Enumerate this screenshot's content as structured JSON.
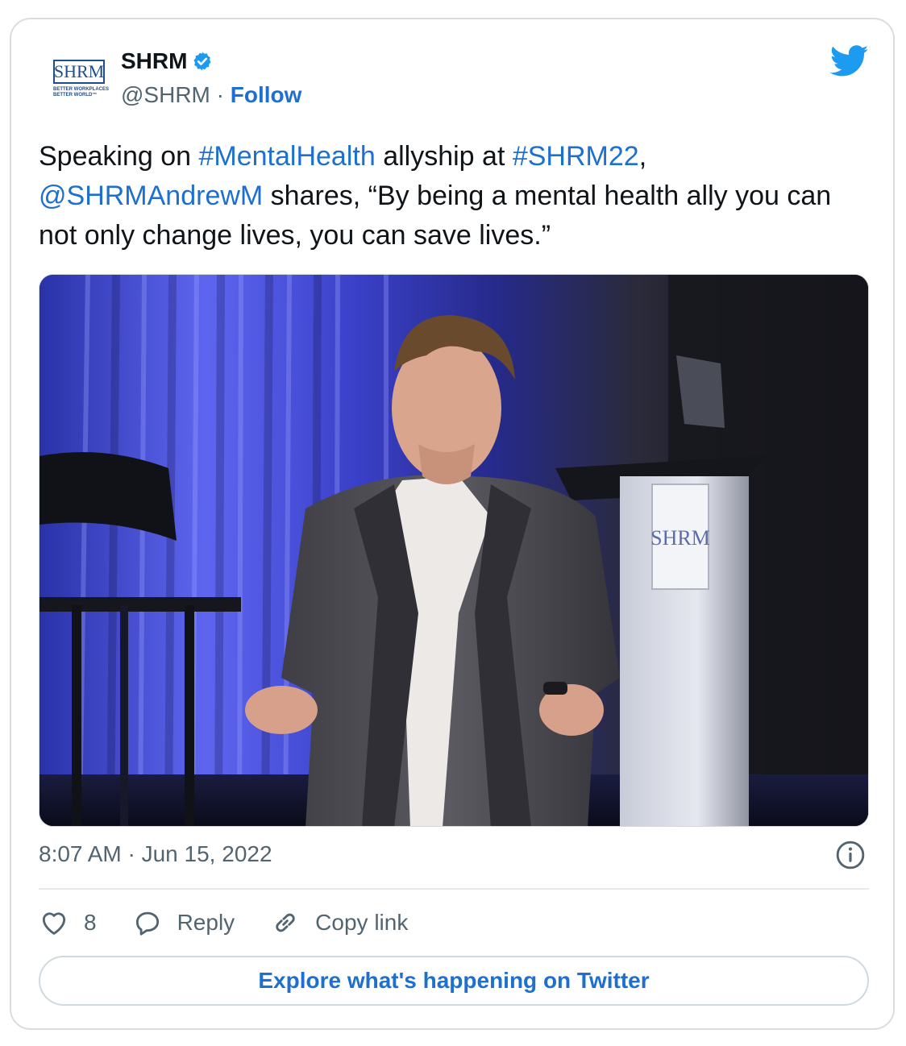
{
  "author": {
    "name": "SHRM",
    "handle": "@SHRM",
    "separator": " · ",
    "follow_label": "Follow",
    "avatar_logo": "SHRM",
    "avatar_tagline": "BETTER WORKPLACES BETTER WORLD™",
    "verified": true
  },
  "tweet": {
    "text_parts": [
      {
        "text": "Speaking on ",
        "link": false
      },
      {
        "text": "#MentalHealth",
        "link": true
      },
      {
        "text": " allyship at ",
        "link": false
      },
      {
        "text": "#SHRM22",
        "link": true
      },
      {
        "text": ", ",
        "link": false
      },
      {
        "text": "@SHRMAndrewM",
        "link": true
      },
      {
        "text": " shares, “By being a mental health ally you can not only change lives, you can save lives.”",
        "link": false
      }
    ],
    "photo_podium_logo": "SHRM",
    "timestamp": "8:07 AM · Jun 15, 2022"
  },
  "actions": {
    "like_count": "8",
    "reply_label": "Reply",
    "copy_link_label": "Copy link",
    "explore_label": "Explore what's happening on Twitter"
  },
  "colors": {
    "link": "#1d6fd0",
    "secondary_text": "#536471",
    "twitter_blue": "#1d9bf0",
    "border": "#cfd9de"
  },
  "icons": [
    "twitter-bird-icon",
    "verified-badge-icon",
    "info-icon",
    "heart-icon",
    "reply-bubble-icon",
    "link-icon"
  ]
}
